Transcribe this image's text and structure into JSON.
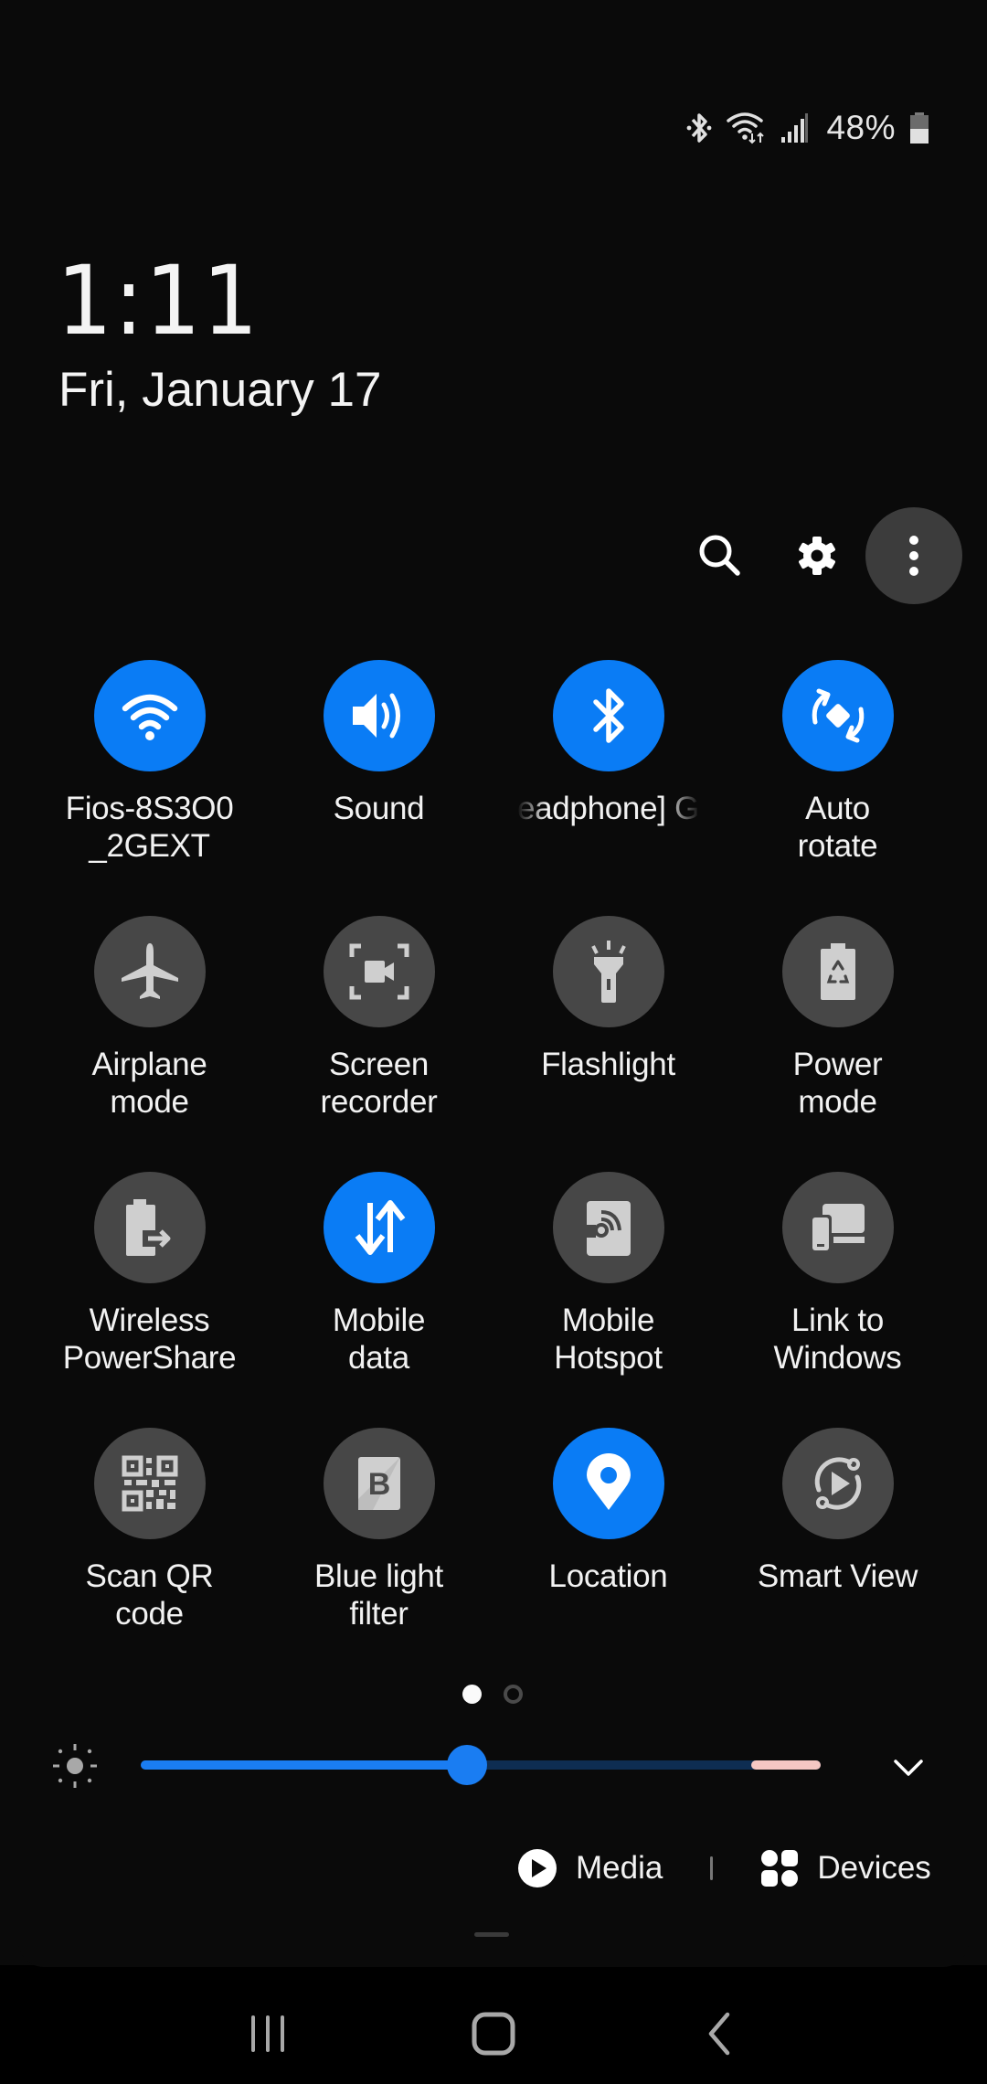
{
  "status_bar": {
    "icons": [
      "bluetooth-icon",
      "wifi-data-icon",
      "cell-signal-icon",
      "battery-icon"
    ],
    "battery_percent": "48%",
    "battery_level": 0.48
  },
  "lockinfo": {
    "time": "1:11",
    "date": "Fri, January 17"
  },
  "actions": {
    "search": "search-icon",
    "settings": "gear-icon",
    "more": "more-vertical-icon"
  },
  "tiles": [
    {
      "label": "Fios-8S3O0\n_2GEXT",
      "icon": "wifi-icon",
      "on": true
    },
    {
      "label": "Sound",
      "icon": "sound-icon",
      "on": true
    },
    {
      "label": "eadphone] G",
      "icon": "bluetooth-icon",
      "on": true
    },
    {
      "label": "Auto\nrotate",
      "icon": "auto-rotate-icon",
      "on": true
    },
    {
      "label": "Airplane\nmode",
      "icon": "airplane-icon",
      "on": false
    },
    {
      "label": "Screen\nrecorder",
      "icon": "screen-recorder-icon",
      "on": false
    },
    {
      "label": "Flashlight",
      "icon": "flashlight-icon",
      "on": false
    },
    {
      "label": "Power\nmode",
      "icon": "power-mode-icon",
      "on": false
    },
    {
      "label": "Wireless\nPowerShare",
      "icon": "wireless-powershare-icon",
      "on": false
    },
    {
      "label": "Mobile\ndata",
      "icon": "mobile-data-icon",
      "on": true
    },
    {
      "label": "Mobile\nHotspot",
      "icon": "mobile-hotspot-icon",
      "on": false
    },
    {
      "label": "Link to\nWindows",
      "icon": "link-to-windows-icon",
      "on": false
    },
    {
      "label": "Scan QR\ncode",
      "icon": "qr-code-icon",
      "on": false
    },
    {
      "label": "Blue light\nfilter",
      "icon": "blue-light-filter-icon",
      "on": false
    },
    {
      "label": "Location",
      "icon": "location-icon",
      "on": true
    },
    {
      "label": "Smart View",
      "icon": "smart-view-icon",
      "on": false
    }
  ],
  "pager": {
    "current_page": 1,
    "total_pages": 2
  },
  "brightness": {
    "value": 0.48,
    "label": "Brightness"
  },
  "media_label": "Media",
  "devices_label": "Devices",
  "colors": {
    "accent": "#0a7cf5",
    "tile_off": "#474747",
    "background": "#0a0a0a"
  },
  "navbar": {
    "recents": "recents-icon",
    "home": "home-icon",
    "back": "back-icon"
  }
}
